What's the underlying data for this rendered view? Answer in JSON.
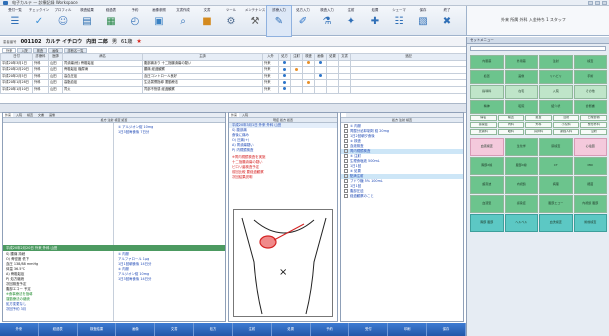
{
  "titlebar": {
    "title": "电子カルテ — 診療記録 Workspace"
  },
  "toolbar": {
    "items": [
      {
        "label": "受付一覧",
        "icon": "list-icon",
        "color": "#2f6fb7"
      },
      {
        "label": "チェックイン",
        "icon": "checkin-icon",
        "color": "#3a8fd6"
      },
      {
        "label": "プロフィル",
        "icon": "profile-icon",
        "color": "#4a7fc0"
      },
      {
        "label": "検査結果",
        "icon": "chart-icon",
        "color": "#2a6db0"
      },
      {
        "label": "経過表",
        "icon": "graph-icon",
        "color": "#2c8a4b"
      },
      {
        "label": "予約",
        "icon": "clock-icon",
        "color": "#2f6fb7"
      },
      {
        "label": "画像参照",
        "icon": "image-icon",
        "color": "#3b82c4"
      },
      {
        "label": "文書作成",
        "icon": "search-icon",
        "color": "#2f6fb7"
      },
      {
        "label": "文書",
        "icon": "folder-icon",
        "color": "#d48a1f"
      },
      {
        "label": "ツール",
        "icon": "gear-icon",
        "color": "#4d6a8f"
      },
      {
        "label": "メンテナンス",
        "icon": "wrench-icon",
        "color": "#5a5a5a"
      },
      {
        "label": "診療入力",
        "icon": "pen-icon",
        "color": "#2f6fb7"
      },
      {
        "label": "処方入力",
        "icon": "rx-icon",
        "color": "#2a73c9"
      },
      {
        "label": "検査入力",
        "icon": "flask-icon",
        "color": "#2f6fb7"
      },
      {
        "label": "注射",
        "icon": "syringe-icon",
        "color": "#2f6fb7"
      },
      {
        "label": "処置",
        "icon": "bandage-icon",
        "color": "#2f6fb7"
      },
      {
        "label": "シェーマ",
        "icon": "schema-icon",
        "color": "#2f6fb7"
      },
      {
        "label": "保存",
        "icon": "save-icon",
        "color": "#2f6fb7"
      },
      {
        "label": "終了",
        "icon": "close-icon",
        "color": "#2f6fb7"
      }
    ]
  },
  "rinfo": {
    "text": "外来 所属 外科 入金待ち 1 スタッフ"
  },
  "patient": {
    "label": "患者番号",
    "id": "001102",
    "kana": "カルテ イチロウ",
    "name": "内田 二郎",
    "sex": "男",
    "age": "61歳",
    "star": "★"
  },
  "history_tabs": [
    "外来",
    "入院",
    "検査",
    "画像",
    "診断名一覧"
  ],
  "history_table": {
    "headers": [
      "日付",
      "診療科",
      "医師",
      "病名",
      "主訴",
      "入外",
      "処方",
      "注射",
      "検査",
      "画像",
      "処置",
      "文書",
      "追記"
    ],
    "rows": [
      [
        "平成20年3月1日",
        "外科",
        "山田",
        "胃潰瘍(他) 骨粗鬆症",
        "腹部痛あり 十二指腸潰瘍の疑い",
        "外来",
        "b",
        "",
        "o",
        "b",
        "",
        "",
        ""
      ],
      [
        "平成20年2月20日",
        "外科",
        "山田",
        "骨粗鬆症 糖尿病",
        "腰痛 経過観察",
        "外来",
        "b",
        "o",
        "",
        "",
        "",
        "",
        ""
      ],
      [
        "平成20年2月5日",
        "外科",
        "山田",
        "高血圧症",
        "血圧コントロール良好",
        "外来",
        "b",
        "",
        "",
        "b",
        "",
        "",
        ""
      ],
      [
        "平成20年1月28日",
        "外科",
        "山田",
        "高脂血症",
        "生活習慣指導 運動療法",
        "外来",
        "b",
        "",
        "o",
        "",
        "",
        "",
        ""
      ],
      [
        "平成20年1月10日",
        "外科",
        "山田",
        "胃炎",
        "胃部不快感 経過観察",
        "外来",
        "b",
        "",
        "",
        "",
        "",
        "",
        ""
      ]
    ]
  },
  "left_panel": {
    "tabs": [
      "外来",
      "入院",
      "検査",
      "文書",
      "画像"
    ],
    "header": "処方 注射 検査 処置",
    "top_lines": [
      "① アルジオン錠 10mg",
      "1日3回毎食後 7日分"
    ],
    "green_bar": "平成20年2月20日 外来 外科 山田",
    "lines": [
      "S) 腰痛 持続",
      "O) 骨密度 低下",
      "血圧 138/88 mmHg",
      "体温 36.5℃",
      "A) 骨粗鬆症",
      "P) 処方継続",
      "次回検査予定",
      "腹部エコー 予定"
    ],
    "green_lines": [
      "※食事療法を指導",
      "運動療法の継続"
    ],
    "blue_lines": [
      "処方変更なし",
      "次回予約 3月"
    ],
    "rx_lines": [
      "① 内服",
      "アルファロール 1μg",
      "1日1回朝食後 14日分",
      "② 内服",
      "アルジオン錠 10mg",
      "1日3回毎食後 14日分"
    ]
  },
  "center_panel": {
    "tabs": [
      "外来",
      "入院"
    ],
    "header": "現症 処方 処置",
    "date_line": "平成20年3月1日 外来 外科 山田",
    "lines": [
      "S) 腹部痛",
      "食後に痛み",
      "O) 圧痛(+)",
      "A) 胃潰瘍疑い",
      "P) 内視鏡検査"
    ],
    "red_lines": [
      "※胃内視鏡検査を実施",
      "十二指腸潰瘍の疑い",
      "ピロリ菌検査予定",
      "前回比較 要経過観察",
      "次回結果説明"
    ]
  },
  "schema": {
    "mark": "×"
  },
  "orders_panel": {
    "header": "処方 注射 検査",
    "lines": [
      "① 内服",
      "胃酸分泌抑制剤 錠 20mg",
      "1日2回朝夕食後",
      "② 検査",
      "血液検査",
      "胃内視鏡検査",
      "③ 注射",
      "生理食塩液 500mL",
      "1日1回",
      "④ 処置",
      "點滴注射",
      "ブドウ糖 5% 100mL",
      "1日1回",
      "腹部圧迫",
      "経過観察のこと"
    ],
    "highlight_indices": [
      5,
      10
    ]
  },
  "bottombar": {
    "items": [
      "外来",
      "経過表",
      "検査結果",
      "画像",
      "文書",
      "処方",
      "注射",
      "処置",
      "予約",
      "受付",
      "印刷",
      "保存"
    ]
  },
  "right_panel": {
    "header": "セットメニュー",
    "grid1": [
      "内服薬",
      "外用薬",
      "注射",
      "検査",
      "処置",
      "画像",
      "リハビリ",
      "手術",
      "指導料",
      "在宅",
      "入院",
      "その他",
      "精神",
      "転院",
      "紹介状",
      "診断書"
    ],
    "grid2": [
      "病名",
      "検査",
      "処置",
      "注射",
      "日常診療",
      "感染症",
      "内科",
      "外科",
      "小児科",
      "整形外科",
      "皮膚科",
      "眼科",
      "耳鼻科",
      "産婦人科",
      "沿約"
    ],
    "grid3": [
      "血液検査",
      "生化学",
      "尿検査",
      "心電図",
      "胸部X線",
      "腹部X線",
      "CT",
      "MRI",
      "超音波",
      "内視鏡",
      "病理",
      "細菌",
      "血液型",
      "感染症",
      "腹部エコー",
      "内視鏡 腹部",
      "胸部 腹部",
      "ヘルペル",
      "血洗検査",
      "術前検査"
    ]
  }
}
